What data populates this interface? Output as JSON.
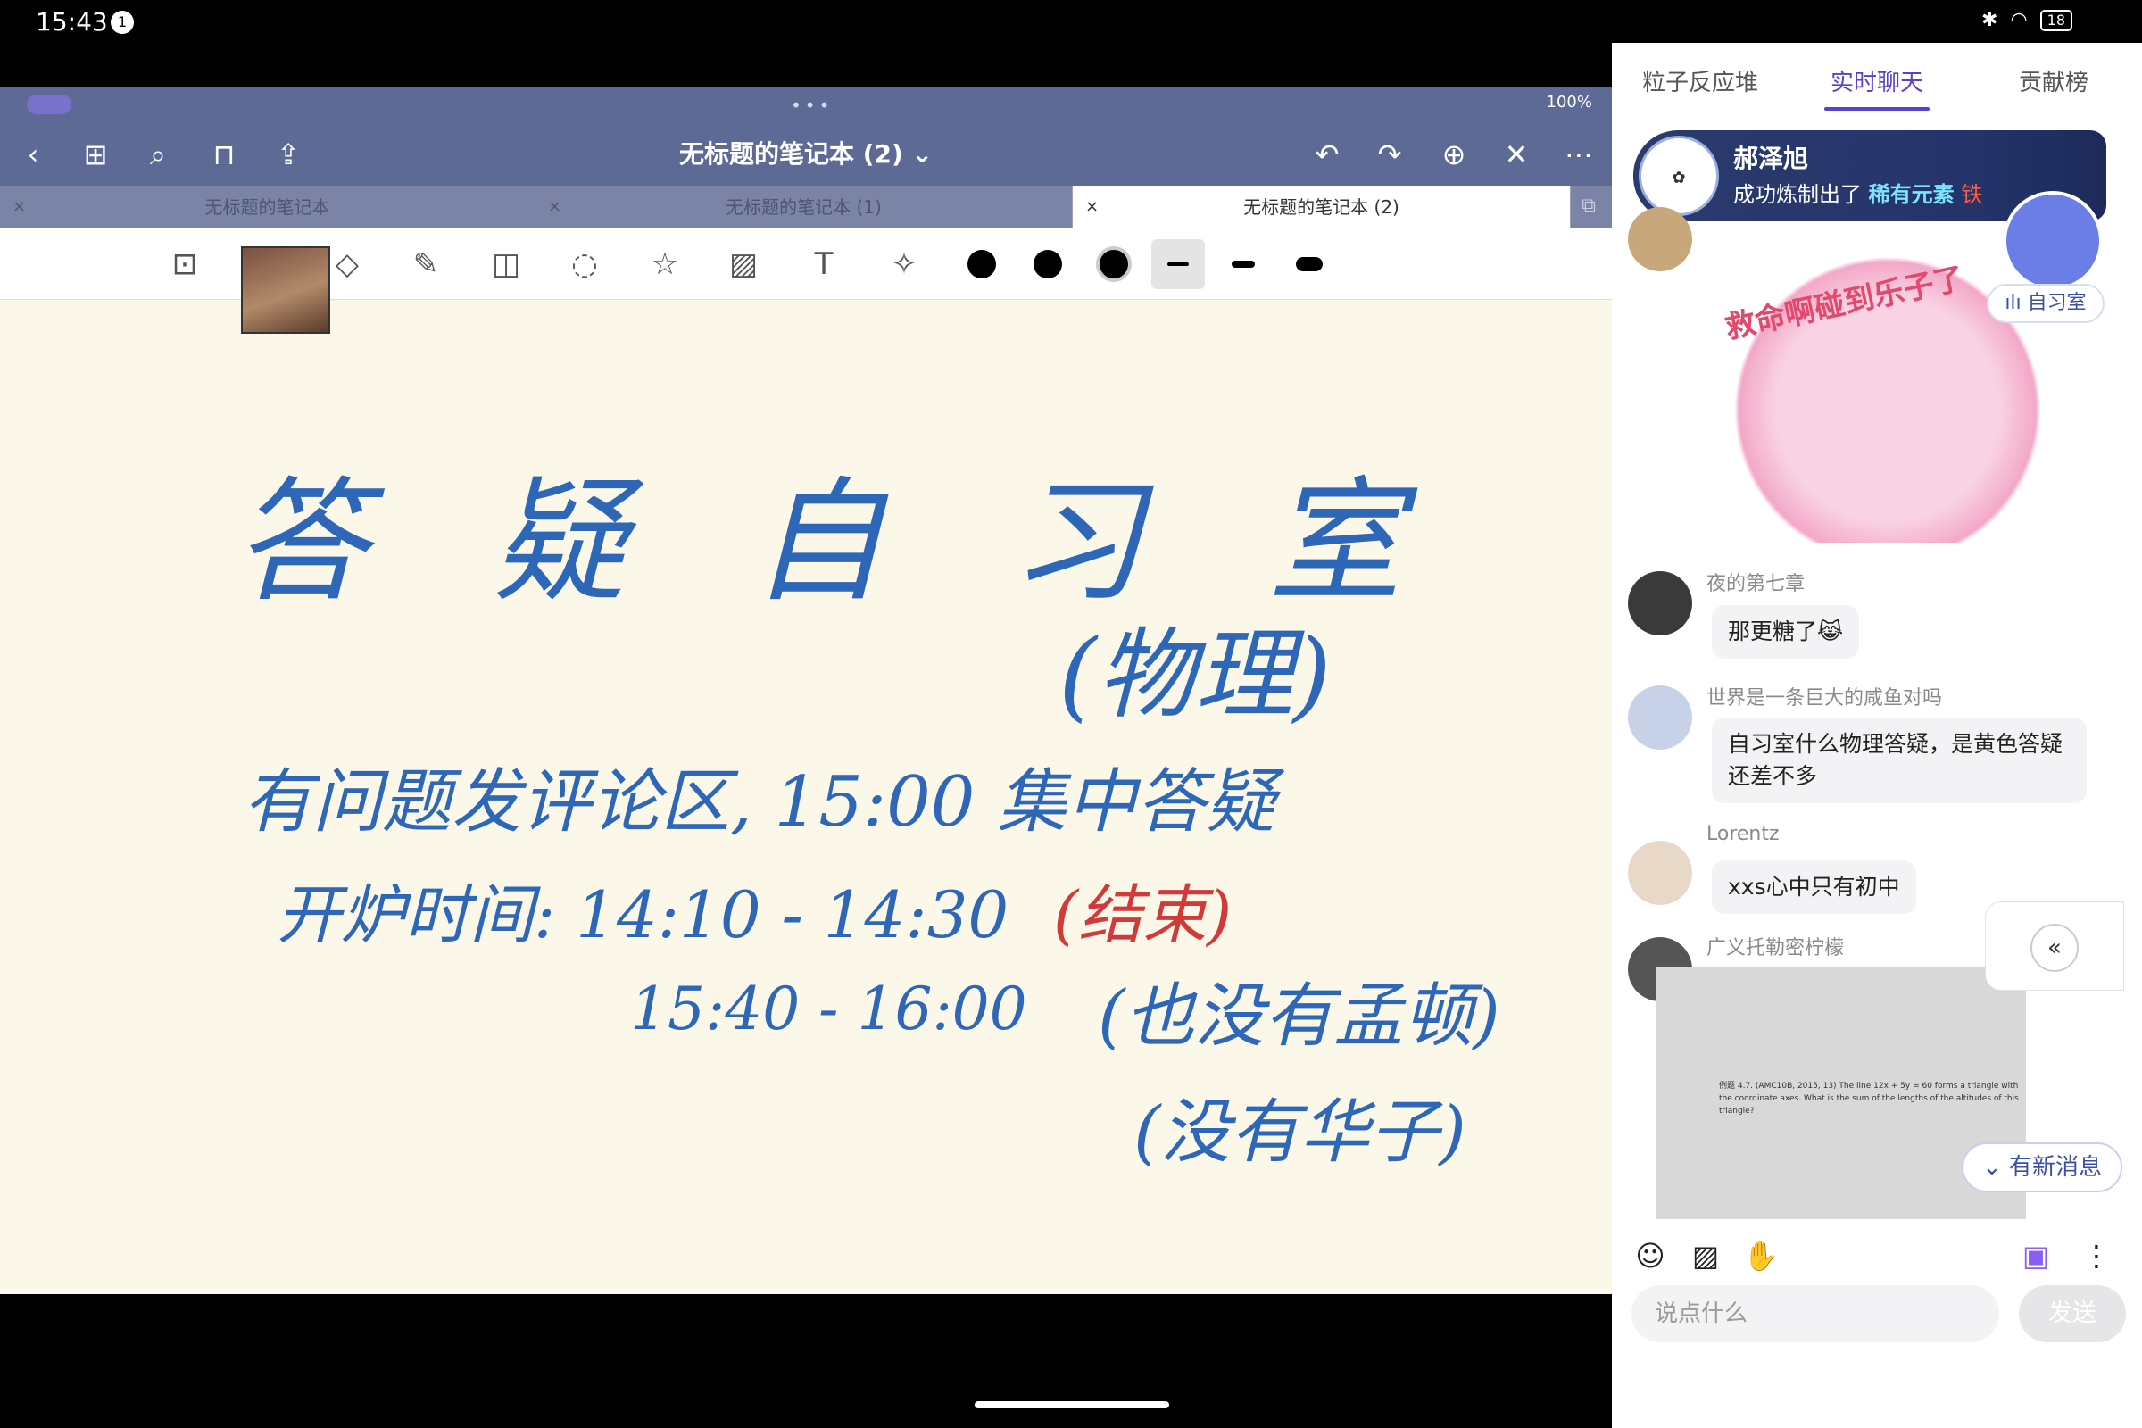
{
  "status_bar": {
    "time": "15:43",
    "notification_count": "1",
    "battery": "18"
  },
  "notes": {
    "window_status": "100%",
    "title": "无标题的笔记本 (2)",
    "tabs": [
      {
        "label": "无标题的笔记本"
      },
      {
        "label": "无标题的笔记本 (1)"
      },
      {
        "label": "无标题的笔记本 (2)"
      }
    ],
    "handwriting": {
      "heading": "答 疑 自 习 室",
      "subheading": "(物理)",
      "line1": "有问题发评论区, 15:00 集中答疑",
      "line2_prefix": "开炉时间: 14:10 - 14:30",
      "line2_end": "(结束)",
      "line3_time": "15:40 - 16:00",
      "line3_note": "(也没有孟顿)",
      "line4": "(没有华子)"
    },
    "colors": {
      "pen_blue": "#2e66b8",
      "pen_red": "#d23a3a",
      "chrome": "#5e6a96"
    }
  },
  "chat": {
    "tabs": [
      {
        "label": "粒子反应堆"
      },
      {
        "label": "实时聊天"
      },
      {
        "label": "贡献榜"
      }
    ],
    "banner": {
      "name": "郝泽旭",
      "message_prefix": "成功炼制出了",
      "rare": "稀有元素",
      "rare_suffix": "铁"
    },
    "room_badge": "自习室",
    "sticker_text": "救命啊碰到乐子了",
    "messages": [
      {
        "user": "夜的第七章",
        "text": "那更糖了😹"
      },
      {
        "user": "世界是一条巨大的咸鱼对吗",
        "text": "自习室什么物理答疑，是黄色答疑还差不多"
      },
      {
        "user": "Lorentz",
        "text": "xxs心中只有初中"
      },
      {
        "user": "广义托勒密柠檬"
      }
    ],
    "image_text": "例题 4.7. (AMC10B, 2015, 13) The line 12x + 5y = 60 forms a triangle with the coordinate axes. What is the sum of the lengths of the altitudes of this triangle?",
    "new_messages": "有新消息",
    "input_placeholder": "说点什么",
    "send_label": "发送"
  }
}
